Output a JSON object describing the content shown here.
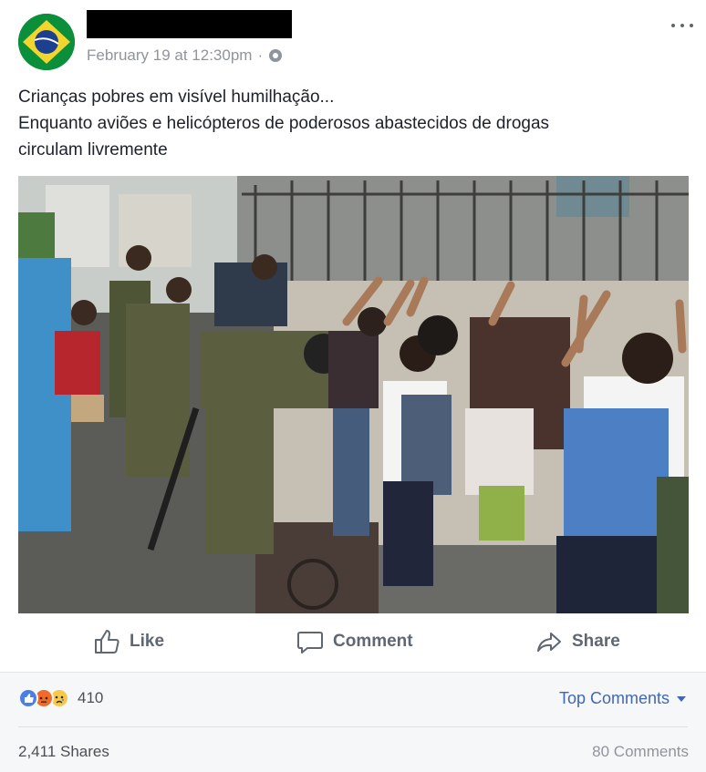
{
  "post": {
    "timestamp": "February 19 at 12:30pm",
    "separator": "·",
    "text_lines": [
      "Crianças pobres em visível humilhação...",
      "Enquanto aviões e helicópteros de poderosos abastecidos de drogas",
      "circulam livremente"
    ]
  },
  "actions": {
    "like": "Like",
    "comment": "Comment",
    "share": "Share"
  },
  "stats": {
    "reactions": [
      "like-reaction",
      "angry-reaction",
      "sad-reaction"
    ],
    "reaction_count": "410",
    "sort_label": "Top Comments",
    "shares": "2,411 Shares",
    "comments": "80 Comments"
  },
  "colors": {
    "link": "#4267b2",
    "muted": "#90949c",
    "like_blue": "#4a7fe7",
    "angry_orange": "#f06a2a",
    "sad_yellow": "#f7c948"
  }
}
